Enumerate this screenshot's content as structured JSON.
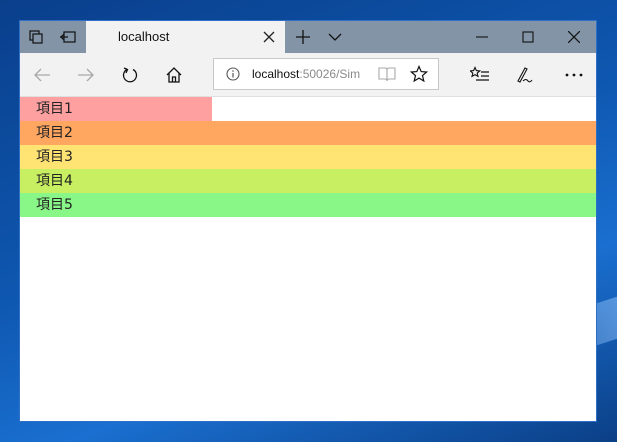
{
  "tab": {
    "title": "localhost"
  },
  "address": {
    "host": "localhost",
    "rest": ":50026/Sim"
  },
  "icons": {
    "tab_actions": "tabs-aside-icon",
    "set_aside": "set-tabs-aside-icon",
    "close_tab": "close-icon",
    "new_tab": "plus-icon",
    "tab_list": "chevron-down-icon",
    "back": "arrow-left-icon",
    "forward": "arrow-right-icon",
    "refresh": "refresh-icon",
    "home": "home-icon",
    "info": "info-icon",
    "reading_view": "book-icon",
    "favorite": "star-icon",
    "favorites_hub": "favorites-list-icon",
    "notes": "pen-icon",
    "more": "ellipsis-icon"
  },
  "items": [
    {
      "label": "項目1",
      "color": "#ffa0a0"
    },
    {
      "label": "項目2",
      "color": "#ffa661"
    },
    {
      "label": "項目3",
      "color": "#ffe473"
    },
    {
      "label": "項目4",
      "color": "#c8ee61"
    },
    {
      "label": "項目5",
      "color": "#88f788"
    }
  ]
}
